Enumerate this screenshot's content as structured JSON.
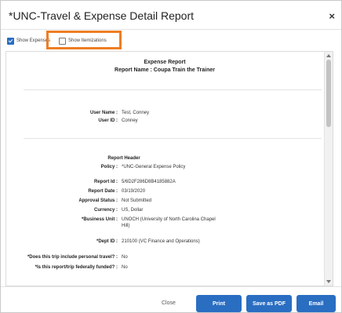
{
  "dialog": {
    "title": "*UNC-Travel & Expense Detail Report",
    "close_glyph": "×"
  },
  "options": {
    "show_expenses": {
      "label": "Show Expenses",
      "checked": true
    },
    "show_itemizations": {
      "label": "Show Itemizations",
      "checked": false
    }
  },
  "report": {
    "heading": "Expense Report",
    "name_line": "Report Name : Coupa Train the Trainer",
    "user": [
      {
        "label": "User Name :",
        "value": "Test, Conney"
      },
      {
        "label": "User ID :",
        "value": "Conney"
      }
    ],
    "header_title": "Report Header",
    "header_fields": [
      {
        "label": "Policy :",
        "value": "*UNC-General Expense Policy"
      },
      {
        "label": "Report Id :",
        "value": "5/6D2F286D8B4185882A"
      },
      {
        "label": "Report Date :",
        "value": "03/19/2020"
      },
      {
        "label": "Approval Status :",
        "value": "Not Submitted"
      },
      {
        "label": "Currency :",
        "value": "US, Dollar"
      },
      {
        "label": "*Business Unit :",
        "value": "UNOCH (University of North Carolina Chapel Hill)"
      },
      {
        "label": "*Dept ID :",
        "value": "210100 (VC Finance and Operations)"
      },
      {
        "label": "*Does this trip include personal travel? :",
        "value": "No"
      },
      {
        "label": "*Is this report/trip federally funded? :",
        "value": "No"
      }
    ]
  },
  "footer": {
    "close_label": "Close",
    "print_label": "Print",
    "save_pdf_label": "Save as PDF",
    "email_label": "Email"
  },
  "colors": {
    "accent": "#2a6ec2",
    "highlight": "#ef7d22"
  }
}
